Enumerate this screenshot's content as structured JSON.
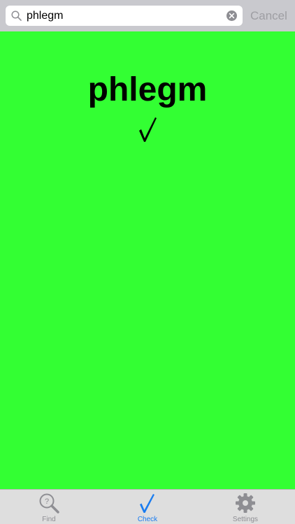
{
  "search": {
    "value": "phlegm",
    "cancel_label": "Cancel"
  },
  "result": {
    "word": "phlegm",
    "status_icon": "checkmark-icon",
    "background_color": "#33ff33"
  },
  "tabs": [
    {
      "label": "Find",
      "icon": "magnifier-question-icon",
      "selected": false
    },
    {
      "label": "Check",
      "icon": "checkmark-icon",
      "selected": true
    },
    {
      "label": "Settings",
      "icon": "gear-icon",
      "selected": false
    }
  ],
  "colors": {
    "accent": "#1a7cf0",
    "inactive": "#8e8e93"
  }
}
